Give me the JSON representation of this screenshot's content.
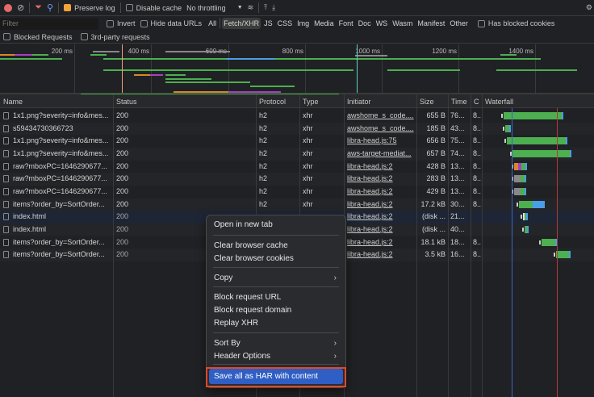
{
  "toolbar": {
    "preserve_log": "Preserve log",
    "preserve_log_checked": true,
    "disable_cache": "Disable cache",
    "throttling": "No throttling"
  },
  "filterbar": {
    "placeholder": "Filter",
    "invert": "Invert",
    "hide_data_urls": "Hide data URLs",
    "types": [
      "All",
      "Fetch/XHR",
      "JS",
      "CSS",
      "Img",
      "Media",
      "Font",
      "Doc",
      "WS",
      "Wasm",
      "Manifest",
      "Other"
    ],
    "selected_type": "Fetch/XHR",
    "has_blocked_cookies": "Has blocked cookies",
    "blocked_requests": "Blocked Requests",
    "third_party": "3rd-party requests"
  },
  "overview": {
    "ticks": [
      "200 ms",
      "400 ms",
      "600 ms",
      "800 ms",
      "1000 ms",
      "1200 ms",
      "1400 ms"
    ]
  },
  "table": {
    "headers": [
      "Name",
      "Status",
      "Protocol",
      "Type",
      "Initiator",
      "Size",
      "Time",
      "C",
      "Waterfall"
    ],
    "rows": [
      {
        "name": "1x1.png?severity=info&mes...",
        "status": "200",
        "protocol": "h2",
        "type": "xhr",
        "initiator": "awshome_s_code....",
        "size": "655 B",
        "time": "76...",
        "c": "8..."
      },
      {
        "name": "s59434730366723",
        "status": "200",
        "protocol": "h2",
        "type": "xhr",
        "initiator": "awshome_s_code....",
        "size": "185 B",
        "time": "43...",
        "c": "8..."
      },
      {
        "name": "1x1.png?severity=info&mes...",
        "status": "200",
        "protocol": "h2",
        "type": "xhr",
        "initiator": "libra-head.js:75",
        "size": "656 B",
        "time": "75...",
        "c": "8..."
      },
      {
        "name": "1x1.png?severity=info&mes...",
        "status": "200",
        "protocol": "h2",
        "type": "xhr",
        "initiator": "aws-target-mediat...",
        "size": "657 B",
        "time": "74...",
        "c": "8..."
      },
      {
        "name": "raw?mboxPC=1646290677...",
        "status": "200",
        "protocol": "h2",
        "type": "xhr",
        "initiator": "libra-head.js:2",
        "size": "428 B",
        "time": "13...",
        "c": "8..."
      },
      {
        "name": "raw?mboxPC=1646290677...",
        "status": "200",
        "protocol": "h2",
        "type": "xhr",
        "initiator": "libra-head.js:2",
        "size": "283 B",
        "time": "13...",
        "c": "8..."
      },
      {
        "name": "raw?mboxPC=1646290677...",
        "status": "200",
        "protocol": "h2",
        "type": "xhr",
        "initiator": "libra-head.js:2",
        "size": "429 B",
        "time": "13...",
        "c": "8..."
      },
      {
        "name": "items?order_by=SortOrder...",
        "status": "200",
        "protocol": "h2",
        "type": "xhr",
        "initiator": "libra-head.js:2",
        "size": "17.2 kB",
        "time": "30...",
        "c": "8..."
      },
      {
        "name": "index.html",
        "status": "200",
        "protocol": "",
        "type": "",
        "initiator": "libra-head.js:2",
        "size": "(disk ...",
        "time": "21...",
        "c": ""
      },
      {
        "name": "index.html",
        "status": "200",
        "protocol": "",
        "type": "",
        "initiator": "libra-head.js:2",
        "size": "(disk ...",
        "time": "40...",
        "c": ""
      },
      {
        "name": "items?order_by=SortOrder...",
        "status": "200",
        "protocol": "",
        "type": "",
        "initiator": "libra-head.js:2",
        "size": "18.1 kB",
        "time": "18...",
        "c": "8..."
      },
      {
        "name": "items?order_by=SortOrder...",
        "status": "200",
        "protocol": "",
        "type": "",
        "initiator": "libra-head.js:2",
        "size": "3.5 kB",
        "time": "16...",
        "c": "8..."
      }
    ]
  },
  "context_menu": {
    "items": [
      "Open in new tab",
      "Clear browser cache",
      "Clear browser cookies",
      "Copy",
      "Block request URL",
      "Block request domain",
      "Replay XHR",
      "Sort By",
      "Header Options",
      "Save all as HAR with content"
    ],
    "highlighted": "Save all as HAR with content"
  },
  "colors": {
    "accent": "#f2a33a",
    "highlight": "#2f5ec4",
    "annotation": "#e4472b",
    "waiting": "#4caf50",
    "download": "#4a9ee8"
  }
}
